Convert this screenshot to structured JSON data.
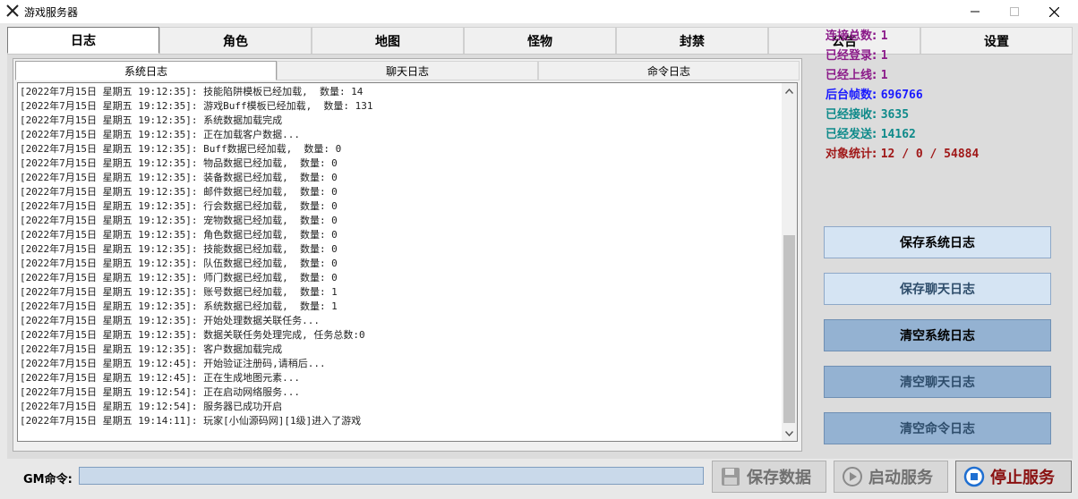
{
  "window": {
    "title": "游戏服务器"
  },
  "main_tabs": [
    "日志",
    "角色",
    "地图",
    "怪物",
    "封禁",
    "公告",
    "设置"
  ],
  "sub_tabs": [
    "系统日志",
    "聊天日志",
    "命令日志"
  ],
  "log_lines": [
    "[2022年7月15日 星期五 19:12:35]: 技能陷阱模板已经加载,  数量: 14",
    "[2022年7月15日 星期五 19:12:35]: 游戏Buff模板已经加载,  数量: 131",
    "[2022年7月15日 星期五 19:12:35]: 系统数据加载完成",
    "[2022年7月15日 星期五 19:12:35]: 正在加载客户数据...",
    "[2022年7月15日 星期五 19:12:35]: Buff数据已经加载,  数量: 0",
    "[2022年7月15日 星期五 19:12:35]: 物品数据已经加载,  数量: 0",
    "[2022年7月15日 星期五 19:12:35]: 装备数据已经加载,  数量: 0",
    "[2022年7月15日 星期五 19:12:35]: 邮件数据已经加载,  数量: 0",
    "[2022年7月15日 星期五 19:12:35]: 行会数据已经加载,  数量: 0",
    "[2022年7月15日 星期五 19:12:35]: 宠物数据已经加载,  数量: 0",
    "[2022年7月15日 星期五 19:12:35]: 角色数据已经加载,  数量: 0",
    "[2022年7月15日 星期五 19:12:35]: 技能数据已经加载,  数量: 0",
    "[2022年7月15日 星期五 19:12:35]: 队伍数据已经加载,  数量: 0",
    "[2022年7月15日 星期五 19:12:35]: 师门数据已经加载,  数量: 0",
    "[2022年7月15日 星期五 19:12:35]: 账号数据已经加载,  数量: 1",
    "[2022年7月15日 星期五 19:12:35]: 系统数据已经加载,  数量: 1",
    "[2022年7月15日 星期五 19:12:35]: 开始处理数据关联任务...",
    "[2022年7月15日 星期五 19:12:35]: 数据关联任务处理完成, 任务总数:0",
    "[2022年7月15日 星期五 19:12:35]: 客户数据加载完成",
    "[2022年7月15日 星期五 19:12:45]: 开始验证注册码,请稍后...",
    "[2022年7月15日 星期五 19:12:45]: 正在生成地图元素...",
    "[2022年7月15日 星期五 19:12:54]: 正在启动网络服务...",
    "[2022年7月15日 星期五 19:12:54]: 服务器已成功开启",
    "[2022年7月15日 星期五 19:14:11]: 玩家[小仙源码网][1级]进入了游戏"
  ],
  "stats": [
    {
      "label": "连接总数:",
      "value": "1",
      "color": "#8b1a89"
    },
    {
      "label": "已经登录:",
      "value": "1",
      "color": "#8b1a89"
    },
    {
      "label": "已经上线:",
      "value": "1",
      "color": "#8b1a89"
    },
    {
      "label": "后台帧数:",
      "value": "696766",
      "color": "#1a1aff"
    },
    {
      "label": "已经接收:",
      "value": "3635",
      "color": "#0e8a8a"
    },
    {
      "label": "已经发送:",
      "value": "14162",
      "color": "#0e8a8a"
    },
    {
      "label": "对象统计:",
      "value": "12 / 0 / 54884",
      "color": "#a01818"
    }
  ],
  "buttons": {
    "save_system_log": "保存系统日志",
    "save_chat_log": "保存聊天日志",
    "clear_system_log": "清空系统日志",
    "clear_chat_log": "清空聊天日志",
    "clear_command_log": "清空命令日志"
  },
  "gm": {
    "label": "GM命令:",
    "value": ""
  },
  "bottom_buttons": {
    "save_data": "保存数据",
    "start_service": "启动服务",
    "stop_service": "停止服务"
  }
}
